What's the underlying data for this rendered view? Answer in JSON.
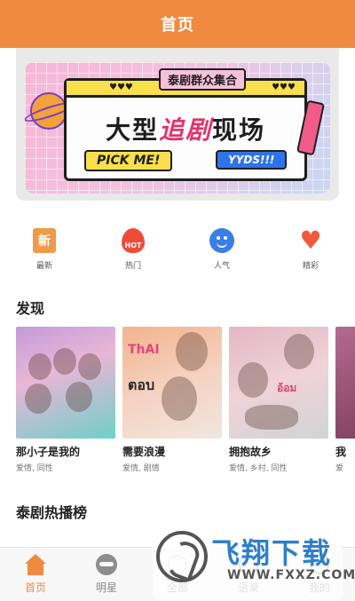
{
  "header": {
    "title": "首页"
  },
  "banner": {
    "tag": "泰剧群众集合",
    "headline_pre": "大型",
    "headline_highlight": "追剧",
    "headline_post": "现场",
    "button_left": "PICK ME!",
    "button_right": "YYDS!!!"
  },
  "quick_nav": [
    {
      "label": "最新",
      "icon": "new-badge-icon",
      "glyph": "新"
    },
    {
      "label": "热门",
      "icon": "hot-flame-icon",
      "glyph": "HOT"
    },
    {
      "label": "人气",
      "icon": "smiley-icon"
    },
    {
      "label": "精彩",
      "icon": "heart-icon",
      "glyph": "♥"
    }
  ],
  "discover": {
    "title": "发现",
    "items": [
      {
        "title": "那小子是我的",
        "tags": "爱情, 同性"
      },
      {
        "title": "需要浪漫",
        "tags": "爱情, 剧情"
      },
      {
        "title": "拥抱故乡",
        "tags": "爱情, 乡村, 同性"
      },
      {
        "title": "我",
        "tags": "爱"
      }
    ]
  },
  "ranking": {
    "title": "泰剧热播榜"
  },
  "tabbar": [
    {
      "label": "首页",
      "icon": "home-icon",
      "active": true
    },
    {
      "label": "明星",
      "icon": "star-mask-icon"
    },
    {
      "label": "全部",
      "icon": "grid-icon"
    },
    {
      "label": "语录",
      "icon": "quote-icon"
    },
    {
      "label": "我的",
      "icon": "profile-icon"
    }
  ],
  "watermark": {
    "cn": "飞翔下载",
    "en": "WWW.FXXZ.COM"
  },
  "colors": {
    "brand": "#ef8a3f",
    "accent_pink": "#e2346b",
    "blue": "#3a7ee6"
  }
}
